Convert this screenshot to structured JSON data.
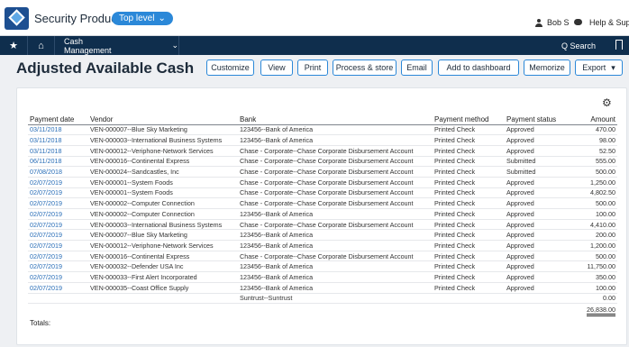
{
  "app": {
    "name": "Security Products",
    "level": "Top level"
  },
  "user": {
    "name": "Bob S",
    "help": "Help & Support"
  },
  "nav": {
    "module": "Cash Management",
    "search": "Q Search"
  },
  "page": {
    "title": "Adjusted Available Cash"
  },
  "toolbar": {
    "customize": "Customize",
    "view": "View",
    "print": "Print",
    "process_store": "Process & store",
    "email": "Email",
    "add_dashboard": "Add to dashboard",
    "memorize": "Memorize",
    "export": "Export"
  },
  "table": {
    "headers": [
      "Payment date",
      "Vendor",
      "Bank",
      "Payment method",
      "Payment status",
      "Amount"
    ],
    "rows": [
      [
        "03/11/2018",
        "VEN-000007--Blue Sky Marketing",
        "123456--Bank of America",
        "Printed Check",
        "Approved",
        "470.00"
      ],
      [
        "03/11/2018",
        "VEN-000003--International Business Systems",
        "123456--Bank of America",
        "Printed Check",
        "Approved",
        "98.00"
      ],
      [
        "03/11/2018",
        "VEN-000012--Veriphone-Network Services",
        "Chase - Corporate--Chase Corporate Disbursement Account",
        "Printed Check",
        "Approved",
        "52.50"
      ],
      [
        "06/11/2018",
        "VEN-000016--Continental Express",
        "Chase - Corporate--Chase Corporate Disbursement Account",
        "Printed Check",
        "Submitted",
        "555.00"
      ],
      [
        "07/08/2018",
        "VEN-000024--Sandcastles, Inc",
        "Chase - Corporate--Chase Corporate Disbursement Account",
        "Printed Check",
        "Submitted",
        "500.00"
      ],
      [
        "02/07/2019",
        "VEN-000001--System Foods",
        "Chase - Corporate--Chase Corporate Disbursement Account",
        "Printed Check",
        "Approved",
        "1,250.00"
      ],
      [
        "02/07/2019",
        "VEN-000001--System Foods",
        "Chase - Corporate--Chase Corporate Disbursement Account",
        "Printed Check",
        "Approved",
        "4,802.50"
      ],
      [
        "02/07/2019",
        "VEN-000002--Computer Connection",
        "Chase - Corporate--Chase Corporate Disbursement Account",
        "Printed Check",
        "Approved",
        "500.00"
      ],
      [
        "02/07/2019",
        "VEN-000002--Computer Connection",
        "123456--Bank of America",
        "Printed Check",
        "Approved",
        "100.00"
      ],
      [
        "02/07/2019",
        "VEN-000003--International Business Systems",
        "Chase - Corporate--Chase Corporate Disbursement Account",
        "Printed Check",
        "Approved",
        "4,410.00"
      ],
      [
        "02/07/2019",
        "VEN-000007--Blue Sky Marketing",
        "123456--Bank of America",
        "Printed Check",
        "Approved",
        "200.00"
      ],
      [
        "02/07/2019",
        "VEN-000012--Veriphone-Network Services",
        "123456--Bank of America",
        "Printed Check",
        "Approved",
        "1,200.00"
      ],
      [
        "02/07/2019",
        "VEN-000016--Continental Express",
        "Chase - Corporate--Chase Corporate Disbursement Account",
        "Printed Check",
        "Approved",
        "500.00"
      ],
      [
        "02/07/2019",
        "VEN-000032--Defender USA Inc",
        "123456--Bank of America",
        "Printed Check",
        "Approved",
        "11,750.00"
      ],
      [
        "02/07/2019",
        "VEN-000033--First Alert Incorporated",
        "123456--Bank of America",
        "Printed Check",
        "Approved",
        "350.00"
      ],
      [
        "02/07/2019",
        "VEN-000035--Coast Office Supply",
        "123456--Bank of America",
        "Printed Check",
        "Approved",
        "100.00"
      ],
      [
        "",
        "",
        "Suntrust--Suntrust",
        "",
        "",
        "0.00"
      ]
    ],
    "totals_label": "Totals:",
    "total_amount": "26,838.00"
  }
}
